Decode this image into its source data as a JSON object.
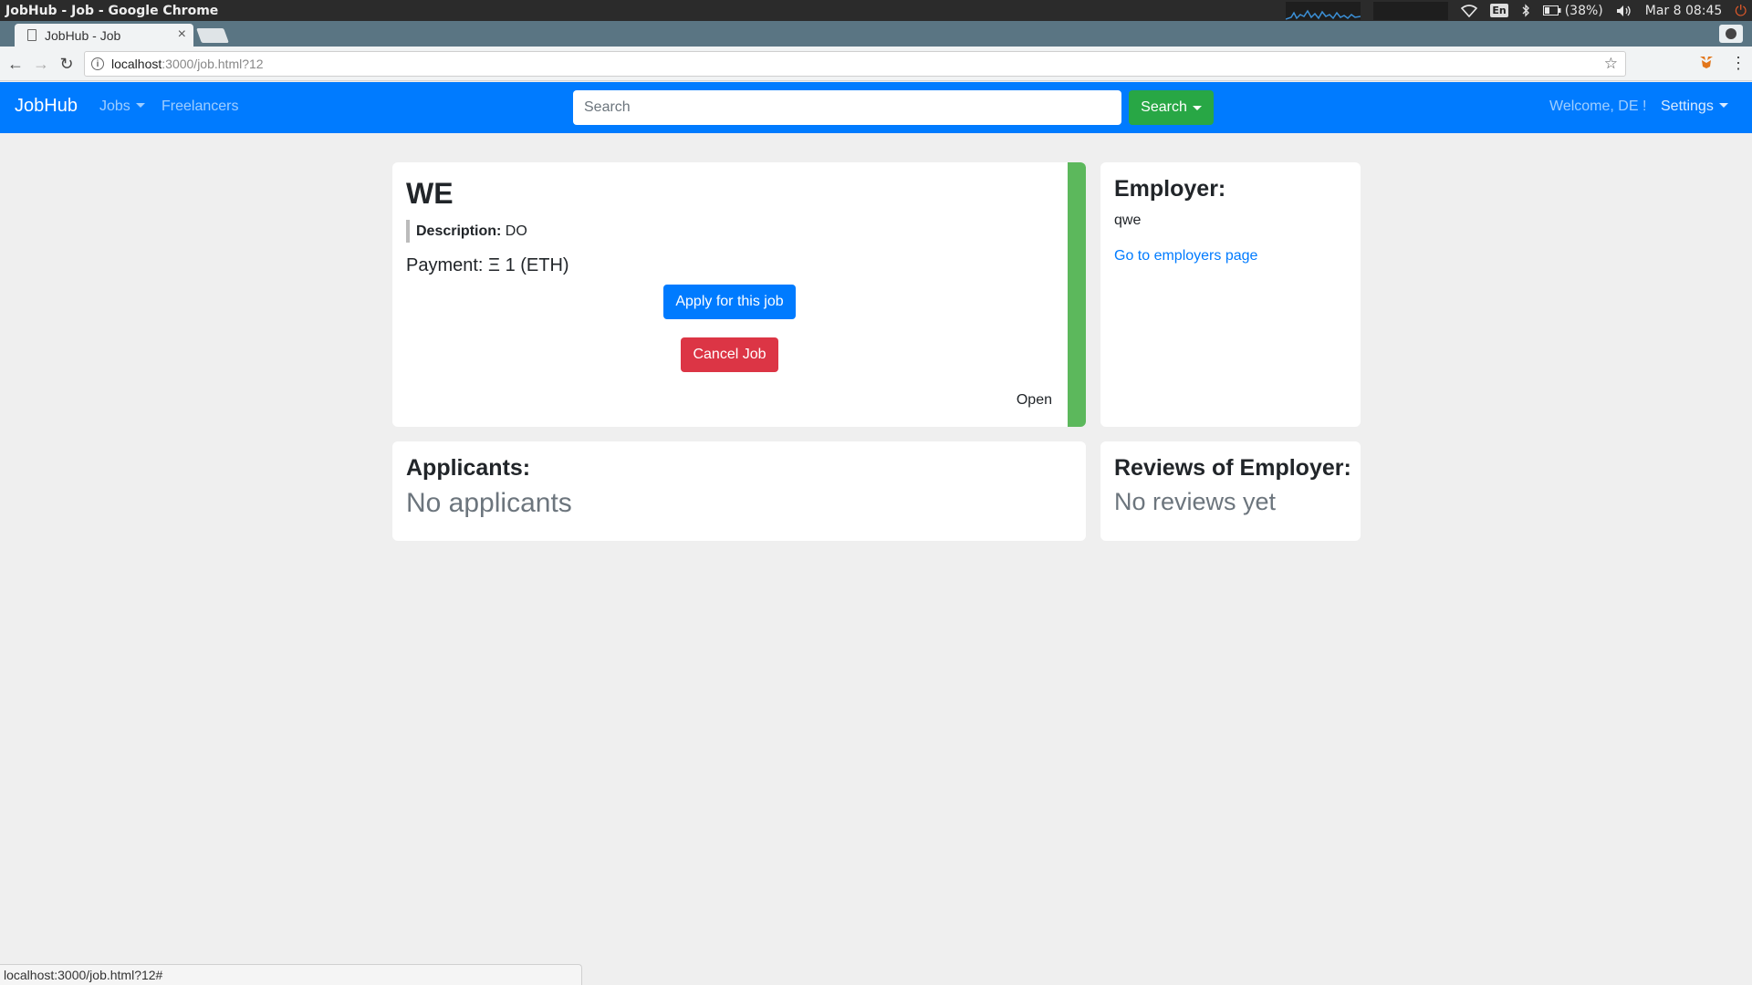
{
  "os": {
    "window_title": "JobHub - Job - Google Chrome",
    "battery": "(38%)",
    "clock": "Mar  8 08:45",
    "keyboard_layout": "En"
  },
  "browser": {
    "tab_title": "JobHub - Job",
    "url_host": "localhost",
    "url_path": ":3000/job.html?12",
    "status_url": "localhost:3000/job.html?12#"
  },
  "navbar": {
    "brand": "JobHub",
    "jobs": "Jobs",
    "freelancers": "Freelancers",
    "search_placeholder": "Search",
    "search_button": "Search",
    "welcome": "Welcome, DE !",
    "settings": "Settings",
    "color": "#007bff"
  },
  "job": {
    "title": "WE",
    "description_label": "Description:",
    "description": "DO",
    "payment": "Payment: Ξ 1 (ETH)",
    "apply_button": "Apply for this job",
    "cancel_button": "Cancel Job",
    "status": "Open",
    "status_color": "#5cb85c"
  },
  "employer": {
    "heading": "Employer:",
    "name": "qwe",
    "link": "Go to employers page"
  },
  "applicants": {
    "heading": "Applicants:",
    "empty": "No applicants"
  },
  "reviews": {
    "heading": "Reviews of Employer:",
    "empty": "No reviews yet"
  }
}
